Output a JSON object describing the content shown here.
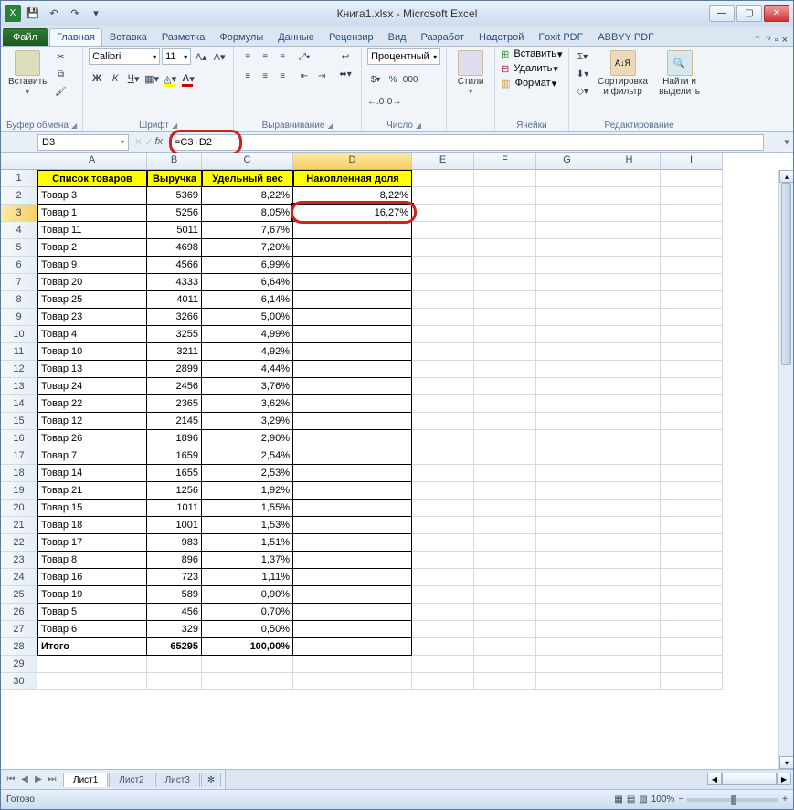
{
  "window": {
    "title": "Книга1.xlsx - Microsoft Excel"
  },
  "qat": {
    "save": "💾",
    "undo": "↶",
    "redo": "↷"
  },
  "tabs": {
    "file": "Файл",
    "items": [
      "Главная",
      "Вставка",
      "Разметка",
      "Формулы",
      "Данные",
      "Рецензир",
      "Вид",
      "Разработ",
      "Надстрой",
      "Foxit PDF",
      "ABBYY PDF"
    ]
  },
  "ribbon": {
    "clipboard": {
      "paste": "Вставить",
      "label": "Буфер обмена"
    },
    "font": {
      "name": "Calibri",
      "size": "11",
      "label": "Шрифт"
    },
    "alignment": {
      "label": "Выравнивание"
    },
    "number": {
      "format": "Процентный",
      "label": "Число"
    },
    "styles": {
      "btn": "Стили",
      "label": ""
    },
    "cells": {
      "insert": "Вставить",
      "delete": "Удалить",
      "format": "Формат",
      "label": "Ячейки"
    },
    "editing": {
      "sort": "Сортировка и фильтр",
      "find": "Найти и выделить",
      "label": "Редактирование"
    }
  },
  "namebox": "D3",
  "formula": "=C3+D2",
  "columns": [
    "A",
    "B",
    "C",
    "D",
    "E",
    "F",
    "G",
    "H",
    "I"
  ],
  "headers": {
    "a": "Список товаров",
    "b": "Выручка",
    "c": "Удельный вес",
    "d": "Накопленная доля"
  },
  "rows": [
    {
      "n": "2",
      "a": "Товар 3",
      "b": "5369",
      "c": "8,22%",
      "d": "8,22%"
    },
    {
      "n": "3",
      "a": "Товар 1",
      "b": "5256",
      "c": "8,05%",
      "d": "16,27%"
    },
    {
      "n": "4",
      "a": "Товар 11",
      "b": "5011",
      "c": "7,67%",
      "d": ""
    },
    {
      "n": "5",
      "a": "Товар 2",
      "b": "4698",
      "c": "7,20%",
      "d": ""
    },
    {
      "n": "6",
      "a": "Товар 9",
      "b": "4566",
      "c": "6,99%",
      "d": ""
    },
    {
      "n": "7",
      "a": "Товар 20",
      "b": "4333",
      "c": "6,64%",
      "d": ""
    },
    {
      "n": "8",
      "a": "Товар 25",
      "b": "4011",
      "c": "6,14%",
      "d": ""
    },
    {
      "n": "9",
      "a": "Товар 23",
      "b": "3266",
      "c": "5,00%",
      "d": ""
    },
    {
      "n": "10",
      "a": "Товар 4",
      "b": "3255",
      "c": "4,99%",
      "d": ""
    },
    {
      "n": "11",
      "a": "Товар 10",
      "b": "3211",
      "c": "4,92%",
      "d": ""
    },
    {
      "n": "12",
      "a": "Товар 13",
      "b": "2899",
      "c": "4,44%",
      "d": ""
    },
    {
      "n": "13",
      "a": "Товар 24",
      "b": "2456",
      "c": "3,76%",
      "d": ""
    },
    {
      "n": "14",
      "a": "Товар 22",
      "b": "2365",
      "c": "3,62%",
      "d": ""
    },
    {
      "n": "15",
      "a": "Товар 12",
      "b": "2145",
      "c": "3,29%",
      "d": ""
    },
    {
      "n": "16",
      "a": "Товар 26",
      "b": "1896",
      "c": "2,90%",
      "d": ""
    },
    {
      "n": "17",
      "a": "Товар 7",
      "b": "1659",
      "c": "2,54%",
      "d": ""
    },
    {
      "n": "18",
      "a": "Товар 14",
      "b": "1655",
      "c": "2,53%",
      "d": ""
    },
    {
      "n": "19",
      "a": "Товар 21",
      "b": "1256",
      "c": "1,92%",
      "d": ""
    },
    {
      "n": "20",
      "a": "Товар 15",
      "b": "1011",
      "c": "1,55%",
      "d": ""
    },
    {
      "n": "21",
      "a": "Товар 18",
      "b": "1001",
      "c": "1,53%",
      "d": ""
    },
    {
      "n": "22",
      "a": "Товар 17",
      "b": "983",
      "c": "1,51%",
      "d": ""
    },
    {
      "n": "23",
      "a": "Товар 8",
      "b": "896",
      "c": "1,37%",
      "d": ""
    },
    {
      "n": "24",
      "a": "Товар 16",
      "b": "723",
      "c": "1,11%",
      "d": ""
    },
    {
      "n": "25",
      "a": "Товар 19",
      "b": "589",
      "c": "0,90%",
      "d": ""
    },
    {
      "n": "26",
      "a": "Товар 5",
      "b": "456",
      "c": "0,70%",
      "d": ""
    },
    {
      "n": "27",
      "a": "Товар 6",
      "b": "329",
      "c": "0,50%",
      "d": ""
    }
  ],
  "total": {
    "n": "28",
    "a": "Итого",
    "b": "65295",
    "c": "100,00%"
  },
  "emptyrows": [
    "29",
    "30"
  ],
  "sheets": [
    "Лист1",
    "Лист2",
    "Лист3"
  ],
  "status": {
    "ready": "Готово",
    "zoom": "100%"
  }
}
